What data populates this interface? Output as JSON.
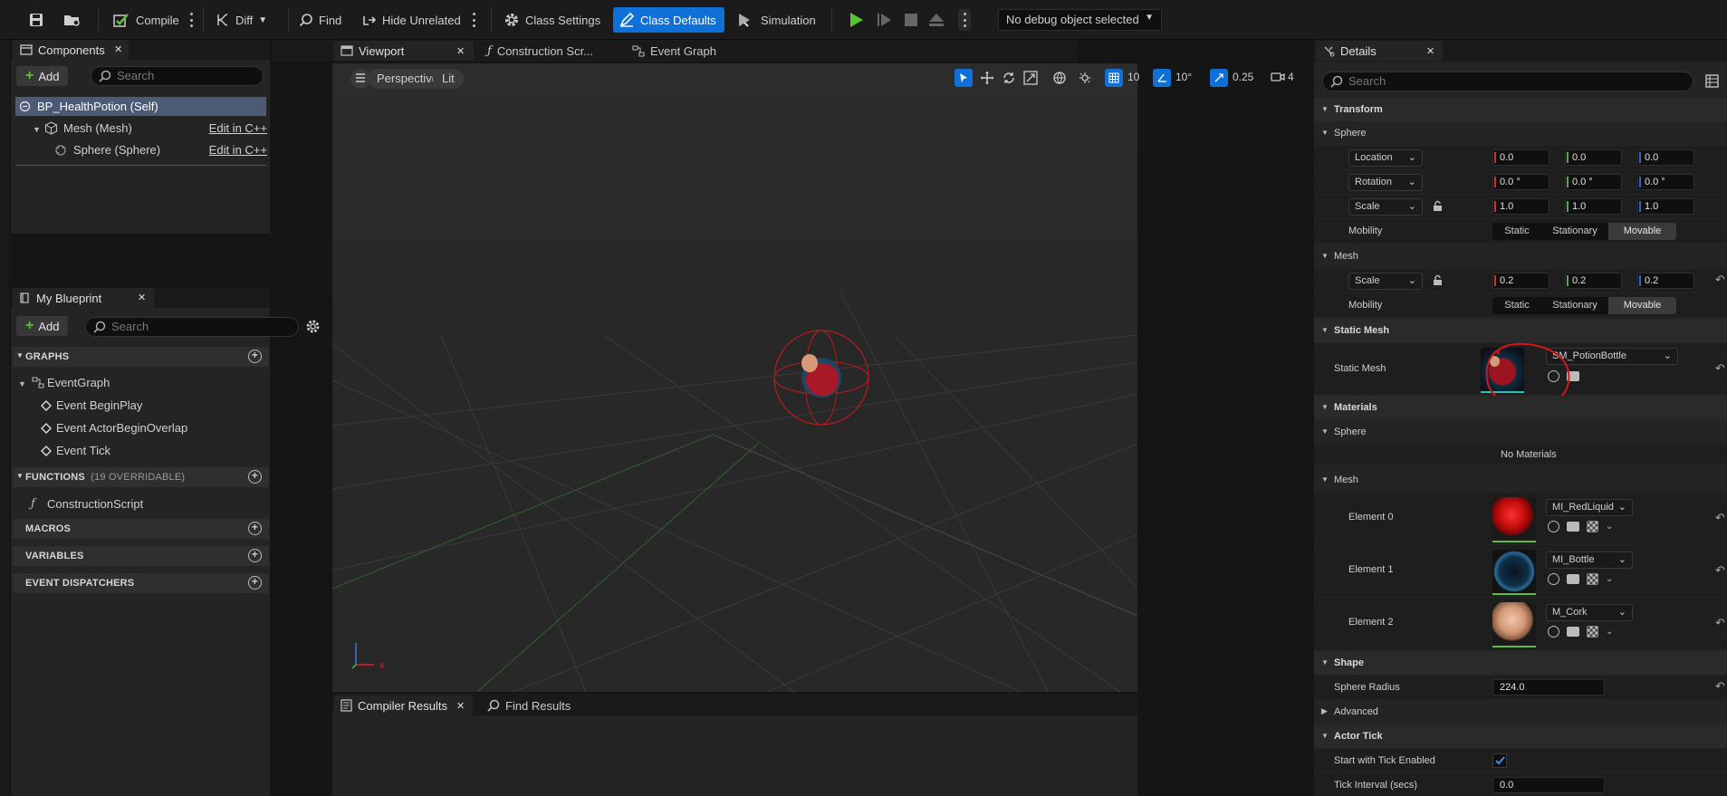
{
  "toolbar": {
    "compile": "Compile",
    "diff": "Diff",
    "find": "Find",
    "hide_unrelated": "Hide Unrelated",
    "class_settings": "Class Settings",
    "class_defaults": "Class Defaults",
    "simulation": "Simulation",
    "debug_object": "No debug object selected",
    "accent": "#0f70d7"
  },
  "components": {
    "title": "Components",
    "add": "Add",
    "search_placeholder": "Search",
    "items": [
      {
        "label": "BP_HealthPotion (Self)"
      },
      {
        "label": "Mesh (Mesh)",
        "edit": "Edit in C++"
      },
      {
        "label": "Sphere (Sphere)",
        "edit": "Edit in C++"
      }
    ]
  },
  "my_blueprint": {
    "title": "My Blueprint",
    "add": "Add",
    "search_placeholder": "Search",
    "graphs_header": "GRAPHS",
    "event_graph": "EventGraph",
    "events": [
      "Event BeginPlay",
      "Event ActorBeginOverlap",
      "Event Tick"
    ],
    "functions_header": "FUNCTIONS",
    "functions_count": "(19 OVERRIDABLE)",
    "construction_script": "ConstructionScript",
    "macros_header": "MACROS",
    "variables_header": "VARIABLES",
    "dispatchers_header": "EVENT DISPATCHERS"
  },
  "tabs": {
    "viewport": "Viewport",
    "construction": "Construction Scr...",
    "event_graph": "Event Graph"
  },
  "viewport": {
    "perspective": "Perspective",
    "lit": "Lit",
    "grid_snap": "10",
    "rot_snap": "10°",
    "scale_snap": "0.25",
    "camera_speed": "4"
  },
  "bottom": {
    "compiler_results": "Compiler Results",
    "find_results": "Find Results"
  },
  "details": {
    "title": "Details",
    "search_placeholder": "Search",
    "transform": "Transform",
    "sphere": "Sphere",
    "mesh": "Mesh",
    "location": "Location",
    "rotation": "Rotation",
    "scale": "Scale",
    "mobility": "Mobility",
    "loc": [
      "0.0",
      "0.0",
      "0.0"
    ],
    "rot": [
      "0.0 °",
      "0.0 °",
      "0.0 °"
    ],
    "scl": [
      "1.0",
      "1.0",
      "1.0"
    ],
    "mesh_scl": [
      "0.2",
      "0.2",
      "0.2"
    ],
    "mob_static": "Static",
    "mob_stationary": "Stationary",
    "mob_movable": "Movable",
    "static_mesh_header": "Static Mesh",
    "static_mesh_label": "Static Mesh",
    "static_mesh_value": "SM_PotionBottle",
    "materials": "Materials",
    "no_materials": "No Materials",
    "element0": "Element 0",
    "element1": "Element 1",
    "element2": "Element 2",
    "mat0": "MI_RedLiquid",
    "mat1": "MI_Bottle",
    "mat2": "M_Cork",
    "shape": "Shape",
    "sphere_radius_label": "Sphere Radius",
    "sphere_radius": "224.0",
    "advanced": "Advanced",
    "actor_tick": "Actor Tick",
    "start_tick": "Start with Tick Enabled",
    "tick_interval_label": "Tick Interval (secs)",
    "tick_interval": "0.0"
  }
}
